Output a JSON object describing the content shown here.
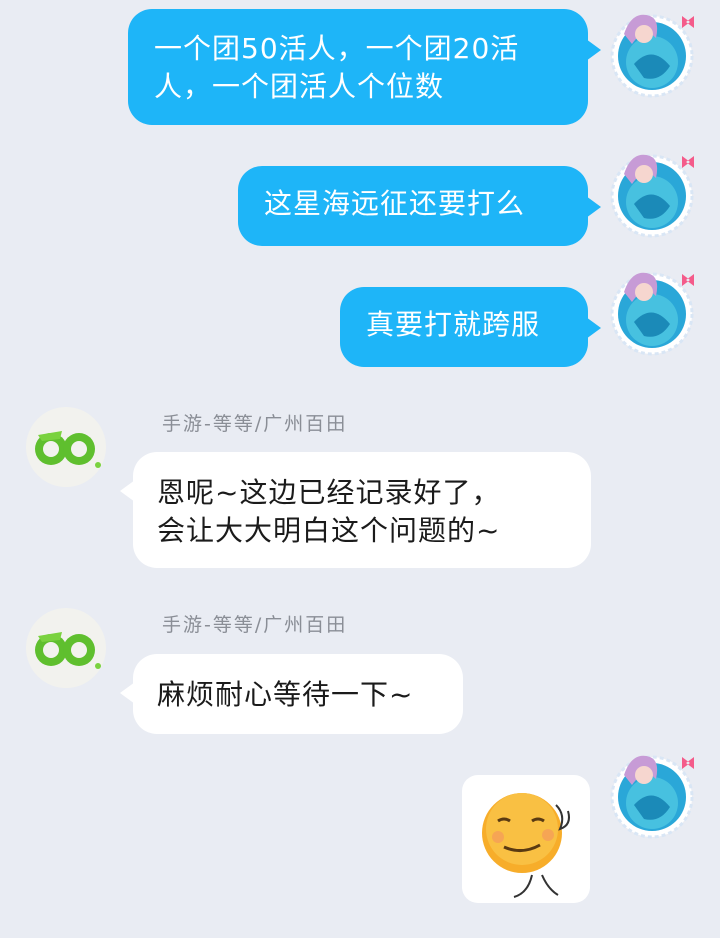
{
  "messages": [
    {
      "side": "out",
      "text": "一个团50活人，一个团20活\n人，一个团活人个位数"
    },
    {
      "side": "out",
      "text": "这星海远征还要打么"
    },
    {
      "side": "out",
      "text": "真要打就跨服"
    },
    {
      "side": "in",
      "sender": "手游-等等/广州百田",
      "text": "恩呢~这边已经记录好了，\n会让大大明白这个问题的~"
    },
    {
      "side": "in",
      "sender": "手游-等等/广州百田",
      "text": "麻烦耐心等待一下~"
    },
    {
      "side": "out",
      "type": "sticker",
      "sticker": "smiling-face-sticker"
    }
  ],
  "colors": {
    "background": "#e9ecf3",
    "outgoing_bubble": "#1eb5f8",
    "incoming_bubble": "#ffffff",
    "sender_name": "#8a8e96"
  },
  "icons": {
    "self_avatar": "mermaid-girl-avatar",
    "agent_avatar": "green-logo-avatar"
  }
}
